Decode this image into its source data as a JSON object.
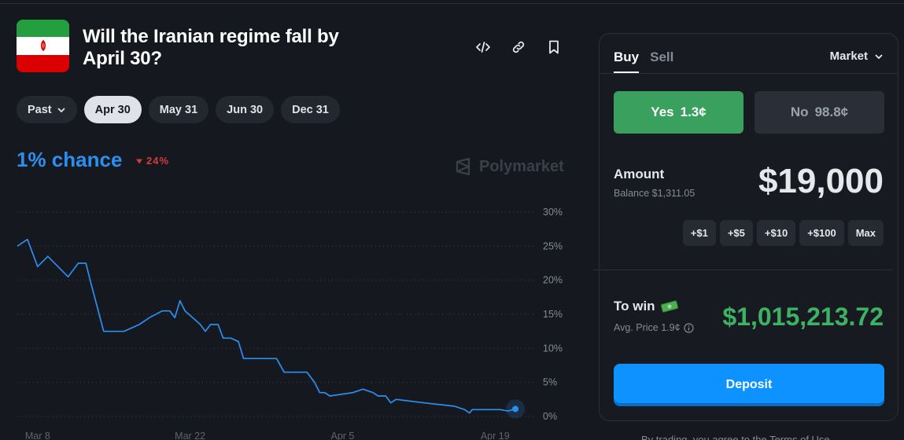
{
  "market": {
    "title": "Will the Iranian regime fall by April 30?",
    "chance": "1% chance",
    "change": "24%",
    "brand": "Polymarket"
  },
  "header_icons": [
    "code-icon",
    "link-icon",
    "bookmark-icon"
  ],
  "date_filters": {
    "past_label": "Past",
    "items": [
      {
        "label": "Apr 30",
        "active": true
      },
      {
        "label": "May 31",
        "active": false
      },
      {
        "label": "Jun 30",
        "active": false
      },
      {
        "label": "Dec 31",
        "active": false
      }
    ]
  },
  "chart_data": {
    "type": "line",
    "series": [
      {
        "color": "#2b8ff0",
        "points": [
          [
            0,
            25
          ],
          [
            2,
            26
          ],
          [
            4,
            22
          ],
          [
            6,
            23.5
          ],
          [
            8,
            22
          ],
          [
            10,
            20.5
          ],
          [
            12,
            22.5
          ],
          [
            13.5,
            22.5
          ],
          [
            14.5,
            19.5
          ],
          [
            17,
            12.5
          ],
          [
            21,
            12.5
          ],
          [
            24,
            13.5
          ],
          [
            26,
            14.5
          ],
          [
            28.5,
            15.5
          ],
          [
            30,
            15.5
          ],
          [
            31,
            14.5
          ],
          [
            32,
            17
          ],
          [
            33,
            15.5
          ],
          [
            34.5,
            14.5
          ],
          [
            36,
            13.5
          ],
          [
            37,
            12.5
          ],
          [
            38,
            13.5
          ],
          [
            39.5,
            13.5
          ],
          [
            40.5,
            11.5
          ],
          [
            42,
            11.5
          ],
          [
            43.5,
            11
          ],
          [
            44.5,
            8.5
          ],
          [
            51,
            8.5
          ],
          [
            52.5,
            6.5
          ],
          [
            57,
            6.5
          ],
          [
            58.5,
            5
          ],
          [
            59.5,
            3.5
          ],
          [
            60.5,
            3.5
          ],
          [
            61.5,
            3
          ],
          [
            66,
            3.5
          ],
          [
            68,
            4
          ],
          [
            70,
            3.5
          ],
          [
            71,
            3
          ],
          [
            72.5,
            3
          ],
          [
            73.5,
            2
          ],
          [
            74.5,
            2.5
          ],
          [
            80,
            2
          ],
          [
            86,
            1.5
          ],
          [
            88,
            1
          ],
          [
            89,
            0.5
          ],
          [
            89.5,
            1
          ],
          [
            95,
            1
          ],
          [
            96.5,
            0.8
          ],
          [
            98,
            1.1
          ]
        ],
        "last_value": 1.1
      }
    ],
    "x_ticks": [
      {
        "label": "Mar 8",
        "x": 4
      },
      {
        "label": "Mar 22",
        "x": 34
      },
      {
        "label": "Apr 5",
        "x": 64
      },
      {
        "label": "Apr 19",
        "x": 94
      }
    ],
    "y_ticks": [
      "30%",
      "25%",
      "20%",
      "15%",
      "10%",
      "5%",
      "0%"
    ],
    "ylim": [
      0,
      30
    ],
    "xlim": [
      0,
      100
    ],
    "grid": true
  },
  "trade": {
    "tabs": [
      {
        "label": "Buy",
        "active": true
      },
      {
        "label": "Sell",
        "active": false
      }
    ],
    "order_type": "Market",
    "yes": {
      "label": "Yes",
      "price": "1.3¢"
    },
    "no": {
      "label": "No",
      "price": "98.8¢"
    },
    "amount_label": "Amount",
    "balance": "Balance $1,311.05",
    "amount_value": "$19,000",
    "quick_amounts": [
      "+$1",
      "+$5",
      "+$10",
      "+$100",
      "Max"
    ],
    "to_win_label": "To win",
    "avg_price": "Avg. Price 1.9¢",
    "to_win_value": "$1,015,213.72",
    "deposit_label": "Deposit",
    "terms": "By trading, you agree to the Terms of Use"
  },
  "colors": {
    "accent_blue": "#2b8ff0",
    "yes_green": "#39a05d",
    "win_green": "#3db264",
    "down_red": "#d53a3a",
    "deposit_blue": "#0d92ff"
  }
}
